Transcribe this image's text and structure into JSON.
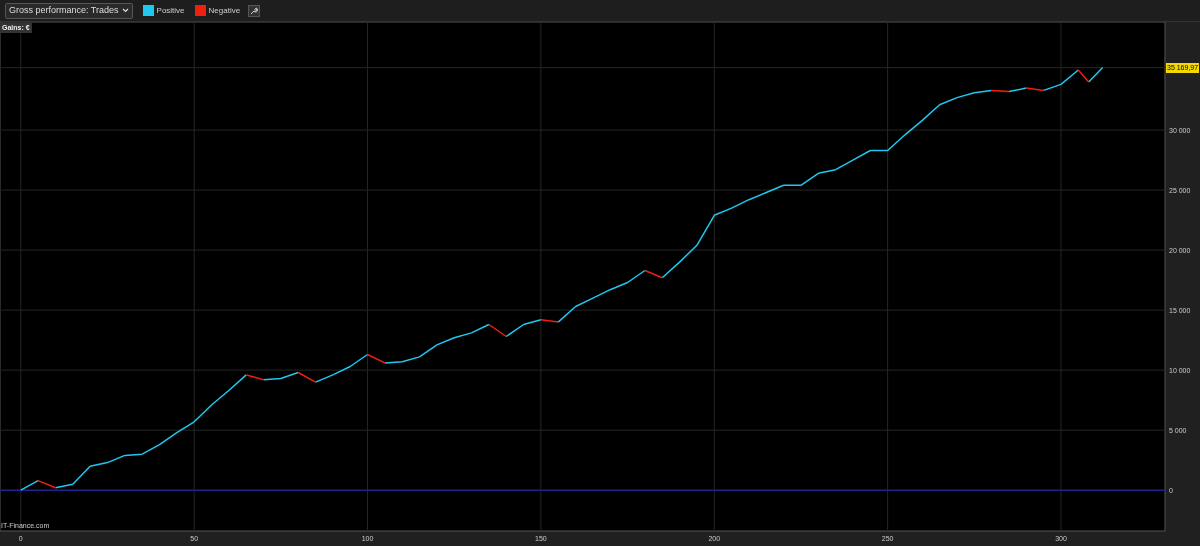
{
  "toolbar": {
    "dropdown": "Gross performance: Trades"
  },
  "chart": {
    "unit_label": "Gains: €",
    "last_value": "35 169,97",
    "source": "IT-Finance.com",
    "chart_data": {
      "type": "line",
      "grid": true,
      "x": [
        0,
        5,
        10,
        15,
        20,
        25,
        30,
        35,
        40,
        45,
        50,
        55,
        60,
        65,
        70,
        75,
        80,
        85,
        90,
        95,
        100,
        105,
        110,
        115,
        120,
        125,
        130,
        135,
        140,
        145,
        150,
        155,
        160,
        165,
        170,
        175,
        180,
        185,
        190,
        195,
        200,
        205,
        210,
        215,
        220,
        225,
        230,
        235,
        240,
        245,
        250,
        255,
        260,
        265,
        270,
        275,
        280,
        285,
        290,
        295,
        300,
        305,
        308,
        312
      ],
      "series": [
        {
          "name": "Positive",
          "color": "#1ec8f0",
          "values": [
            0,
            800,
            200,
            500,
            2000,
            2300,
            2900,
            3000,
            3800,
            4800,
            5700,
            7100,
            8300,
            9600,
            9200,
            9300,
            9800,
            9000,
            9600,
            10300,
            11300,
            10600,
            10700,
            11100,
            12100,
            12700,
            13100,
            13800,
            12800,
            13800,
            14200,
            14000,
            15300,
            16000,
            16700,
            17300,
            18300,
            17700,
            19000,
            20400,
            22900,
            23500,
            24200,
            24800,
            25400,
            25400,
            26400,
            26700,
            27500,
            28300,
            28300,
            29600,
            30800,
            32100,
            32700,
            33100,
            33300,
            33200,
            33500,
            33300,
            33800,
            35000,
            34000,
            35200
          ]
        },
        {
          "name": "Negative",
          "color": "#f02010",
          "values": [
            null,
            800,
            200,
            null,
            null,
            null,
            null,
            null,
            null,
            null,
            null,
            null,
            null,
            9600,
            9200,
            null,
            9800,
            9000,
            null,
            null,
            11300,
            10600,
            null,
            null,
            null,
            null,
            null,
            13800,
            12800,
            null,
            14200,
            14000,
            null,
            null,
            null,
            null,
            18300,
            17700,
            null,
            null,
            null,
            null,
            null,
            null,
            null,
            null,
            null,
            null,
            null,
            null,
            null,
            null,
            null,
            null,
            null,
            null,
            33300,
            33200,
            33500,
            33300,
            null,
            35000,
            34000,
            null
          ]
        }
      ],
      "ref_lines": [
        {
          "axis": "y",
          "value": 0,
          "color": "#22228a"
        }
      ],
      "xlim": [
        -6,
        330
      ],
      "ylim": [
        -3400,
        39000
      ],
      "xticks": [
        0,
        50,
        100,
        150,
        200,
        250,
        300
      ],
      "yticks": [
        {
          "value": 0,
          "label": "0"
        },
        {
          "value": 5000,
          "label": "5 000"
        },
        {
          "value": 10000,
          "label": "10 000"
        },
        {
          "value": 15000,
          "label": "15 000"
        },
        {
          "value": 20000,
          "label": "20 000"
        },
        {
          "value": 25000,
          "label": "25 000"
        },
        {
          "value": 30000,
          "label": "30 000"
        }
      ]
    }
  }
}
